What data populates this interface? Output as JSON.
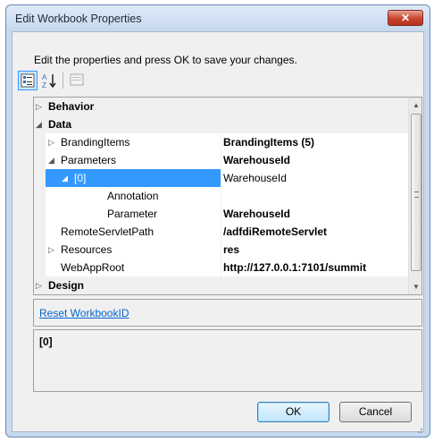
{
  "dialog": {
    "title": "Edit Workbook Properties",
    "close_glyph": "✕",
    "instructions": "Edit the properties and press OK to save your changes."
  },
  "toolbar": {
    "categorized_icon": "categorized-icon",
    "alphabetical_label": "A Z",
    "property_pages_icon": "property-pages-icon"
  },
  "grid": {
    "rows": [
      {
        "name": "Behavior",
        "value": "",
        "kind": "category",
        "expander": "▷"
      },
      {
        "name": "Data",
        "value": "",
        "kind": "category",
        "expander": "◢"
      },
      {
        "name": "BrandingItems",
        "value": "BrandingItems (5)",
        "kind": "property",
        "expander": "▷"
      },
      {
        "name": "Parameters",
        "value": "WarehouseId",
        "kind": "property",
        "expander": "◢"
      },
      {
        "name": "[0]",
        "value": "WarehouseId",
        "kind": "selected",
        "expander": "◢"
      },
      {
        "name": "Annotation",
        "value": "",
        "kind": "property",
        "expander": ""
      },
      {
        "name": "Parameter",
        "value": "WarehouseId",
        "kind": "property",
        "expander": ""
      },
      {
        "name": "RemoteServletPath",
        "value": "/adfdiRemoteServlet",
        "kind": "property",
        "expander": ""
      },
      {
        "name": "Resources",
        "value": "res",
        "kind": "property",
        "expander": "▷"
      },
      {
        "name": "WebAppRoot",
        "value": "http://127.0.0.1:7101/summit",
        "kind": "property",
        "expander": ""
      },
      {
        "name": "Design",
        "value": "",
        "kind": "category",
        "expander": "▷"
      }
    ]
  },
  "commands": {
    "reset_link": "Reset WorkbookID"
  },
  "help": {
    "title": "[0]"
  },
  "buttons": {
    "ok": "OK",
    "cancel": "Cancel"
  },
  "colors": {
    "selection": "#3399ff",
    "link": "#0066cc",
    "title_bar": "#c4d7ee"
  }
}
